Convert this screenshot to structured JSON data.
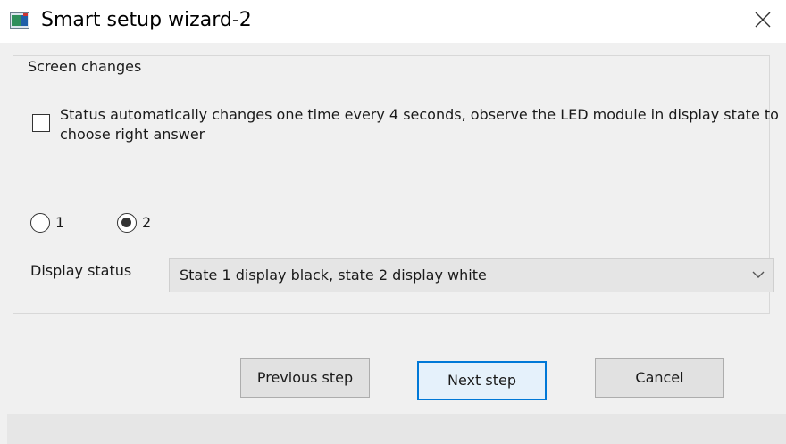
{
  "window": {
    "title": "Smart setup wizard-2",
    "icon": "wizard-app-icon",
    "close_icon": "close-x-icon"
  },
  "group": {
    "label": "Screen changes"
  },
  "checkbox": {
    "label": "Status automatically changes one time every 4 seconds, observe the LED module in display state to choose right answer",
    "checked": false
  },
  "radios": [
    {
      "label": "1",
      "selected": false
    },
    {
      "label": "2",
      "selected": true
    }
  ],
  "display_status": {
    "label": "Display status",
    "selected_value": "State 1 display black, state 2 display white"
  },
  "buttons": {
    "previous": "Previous step",
    "next": "Next step",
    "cancel": "Cancel"
  },
  "colors": {
    "accent": "#0078d7",
    "dialog_bg": "#f0f0f0"
  }
}
